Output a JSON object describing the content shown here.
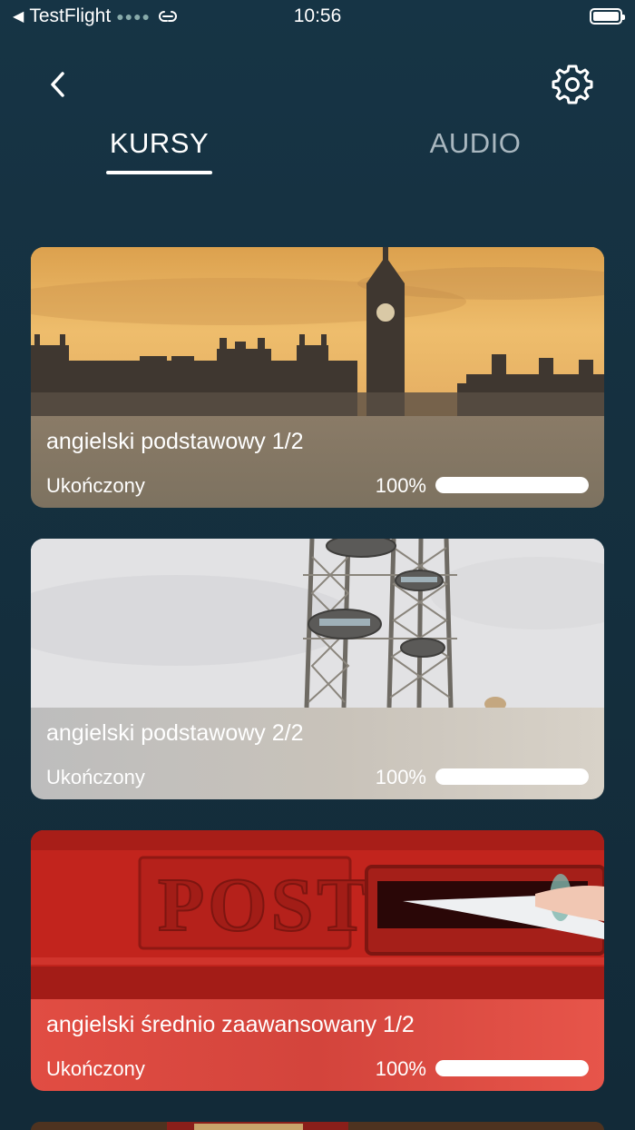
{
  "status_bar": {
    "back_app": "TestFlight",
    "time": "10:56"
  },
  "nav": {
    "back_icon": "chevron-left-icon",
    "settings_icon": "gear-icon"
  },
  "tabs": [
    {
      "label": "KURSY",
      "active": true
    },
    {
      "label": "AUDIO",
      "active": false
    }
  ],
  "courses": [
    {
      "title": "angielski podstawowy 1/2",
      "status": "Ukończony",
      "percent": "100%",
      "progress": 1.0,
      "image": "big-ben-parliament"
    },
    {
      "title": "angielski podstawowy 2/2",
      "status": "Ukończony",
      "percent": "100%",
      "progress": 1.0,
      "image": "london-eye"
    },
    {
      "title": "angielski średnio zaawansowany 1/2",
      "status": "Ukończony",
      "percent": "100%",
      "progress": 1.0,
      "image": "red-post-box"
    }
  ],
  "colors": {
    "background": "#163445",
    "tab_active": "#ffffff",
    "tab_inactive": "#a9b7bf"
  }
}
